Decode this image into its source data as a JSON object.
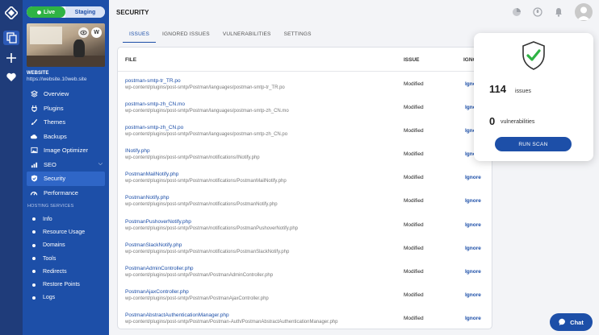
{
  "env": {
    "live": "Live",
    "staging": "Staging"
  },
  "site": {
    "label": "WEBSITE",
    "url": "https://website.10web.site"
  },
  "nav": {
    "items": [
      {
        "label": "Overview",
        "icon": "overview-icon"
      },
      {
        "label": "Plugins",
        "icon": "plugin-icon"
      },
      {
        "label": "Themes",
        "icon": "brush-icon"
      },
      {
        "label": "Backups",
        "icon": "cloud-icon"
      },
      {
        "label": "Image Optimizer",
        "icon": "image-icon"
      },
      {
        "label": "SEO",
        "icon": "chart-icon"
      },
      {
        "label": "Security",
        "icon": "shield-icon"
      },
      {
        "label": "Performance",
        "icon": "gauge-icon"
      }
    ],
    "section": "HOSTING SERVICES",
    "sub": [
      "Info",
      "Resource Usage",
      "Domains",
      "Tools",
      "Redirects",
      "Restore Points",
      "Logs"
    ]
  },
  "page": {
    "title": "SECURITY"
  },
  "tabs": [
    "ISSUES",
    "IGNORED ISSUES",
    "VULNERABILITIES",
    "SETTINGS"
  ],
  "table": {
    "headers": [
      "FILE",
      "ISSUE",
      "IGNO"
    ],
    "rows": [
      {
        "name": "postman-smtp-tr_TR.po",
        "path": "wp-content/plugins/post-smtp/Postman/languages/postman-smtp-tr_TR.po",
        "issue": "Modified",
        "action": "Ignore"
      },
      {
        "name": "postman-smtp-zh_CN.mo",
        "path": "wp-content/plugins/post-smtp/Postman/languages/postman-smtp-zh_CN.mo",
        "issue": "Modified",
        "action": "Ignore"
      },
      {
        "name": "postman-smtp-zh_CN.po",
        "path": "wp-content/plugins/post-smtp/Postman/languages/postman-smtp-zh_CN.po",
        "issue": "Modified",
        "action": "Ignore"
      },
      {
        "name": "INotify.php",
        "path": "wp-content/plugins/post-smtp/Postman/notifications/INotify.php",
        "issue": "Modified",
        "action": "Ignore"
      },
      {
        "name": "PostmanMailNotify.php",
        "path": "wp-content/plugins/post-smtp/Postman/notifications/PostmanMailNotify.php",
        "issue": "Modified",
        "action": "Ignore"
      },
      {
        "name": "PostmanNotify.php",
        "path": "wp-content/plugins/post-smtp/Postman/notifications/PostmanNotify.php",
        "issue": "Modified",
        "action": "Ignore"
      },
      {
        "name": "PostmanPushoverNotify.php",
        "path": "wp-content/plugins/post-smtp/Postman/notifications/PostmanPushoverNotify.php",
        "issue": "Modified",
        "action": "Ignore"
      },
      {
        "name": "PostmanSlackNotify.php",
        "path": "wp-content/plugins/post-smtp/Postman/notifications/PostmanSlackNotify.php",
        "issue": "Modified",
        "action": "Ignore"
      },
      {
        "name": "PostmanAdminController.php",
        "path": "wp-content/plugins/post-smtp/Postman/PostmanAdminController.php",
        "issue": "Modified",
        "action": "Ignore"
      },
      {
        "name": "PostmanAjaxController.php",
        "path": "wp-content/plugins/post-smtp/Postman/PostmanAjaxController.php",
        "issue": "Modified",
        "action": "Ignore"
      },
      {
        "name": "PostmanAbstractAuthenticationManager.php",
        "path": "wp-content/plugins/post-smtp/Postman/Postman-Auth/PostmanAbstractAuthenticationManager.php",
        "issue": "Modified",
        "action": "Ignore"
      }
    ]
  },
  "panel": {
    "issues_count": "114",
    "issues_label": "issues",
    "vuln_count": "0",
    "vuln_label": "vulnerabilities",
    "scan_label": "RUN SCAN"
  },
  "chat": {
    "label": "Chat"
  },
  "colors": {
    "primary": "#1d4fa8",
    "live": "#2fb344",
    "check": "#2fb344"
  }
}
